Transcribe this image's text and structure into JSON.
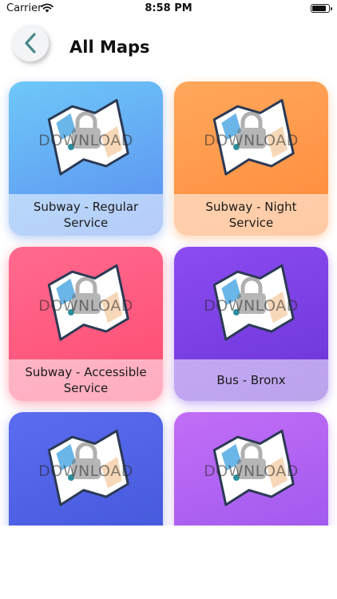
{
  "status_bar": {
    "carrier": "Carrier",
    "time": "8:58 PM",
    "battery_level": 0.9,
    "wifi_icon": "wifi-icon",
    "battery_icon": "battery-icon"
  },
  "header": {
    "title": "All Maps",
    "back_icon": "chevron-left-icon"
  },
  "cards": [
    {
      "label": "Subway - Regular Service",
      "overlay_text": "DOWNLOAD",
      "color": "#6ea0f2"
    },
    {
      "label": "Subway - Night Service",
      "overlay_text": "DOWNLOAD",
      "color": "#ff9a4a"
    },
    {
      "label": "Subway - Accessible Service",
      "overlay_text": "DOWNLOAD",
      "color": "#ff5a80"
    },
    {
      "label": "Bus - Bronx",
      "overlay_text": "DOWNLOAD",
      "color": "#7a40e4"
    },
    {
      "label": "",
      "overlay_text": "DOWNLOAD",
      "color": "#4e60e4"
    },
    {
      "label": "",
      "overlay_text": "DOWNLOAD",
      "color": "#ae62f0"
    }
  ]
}
